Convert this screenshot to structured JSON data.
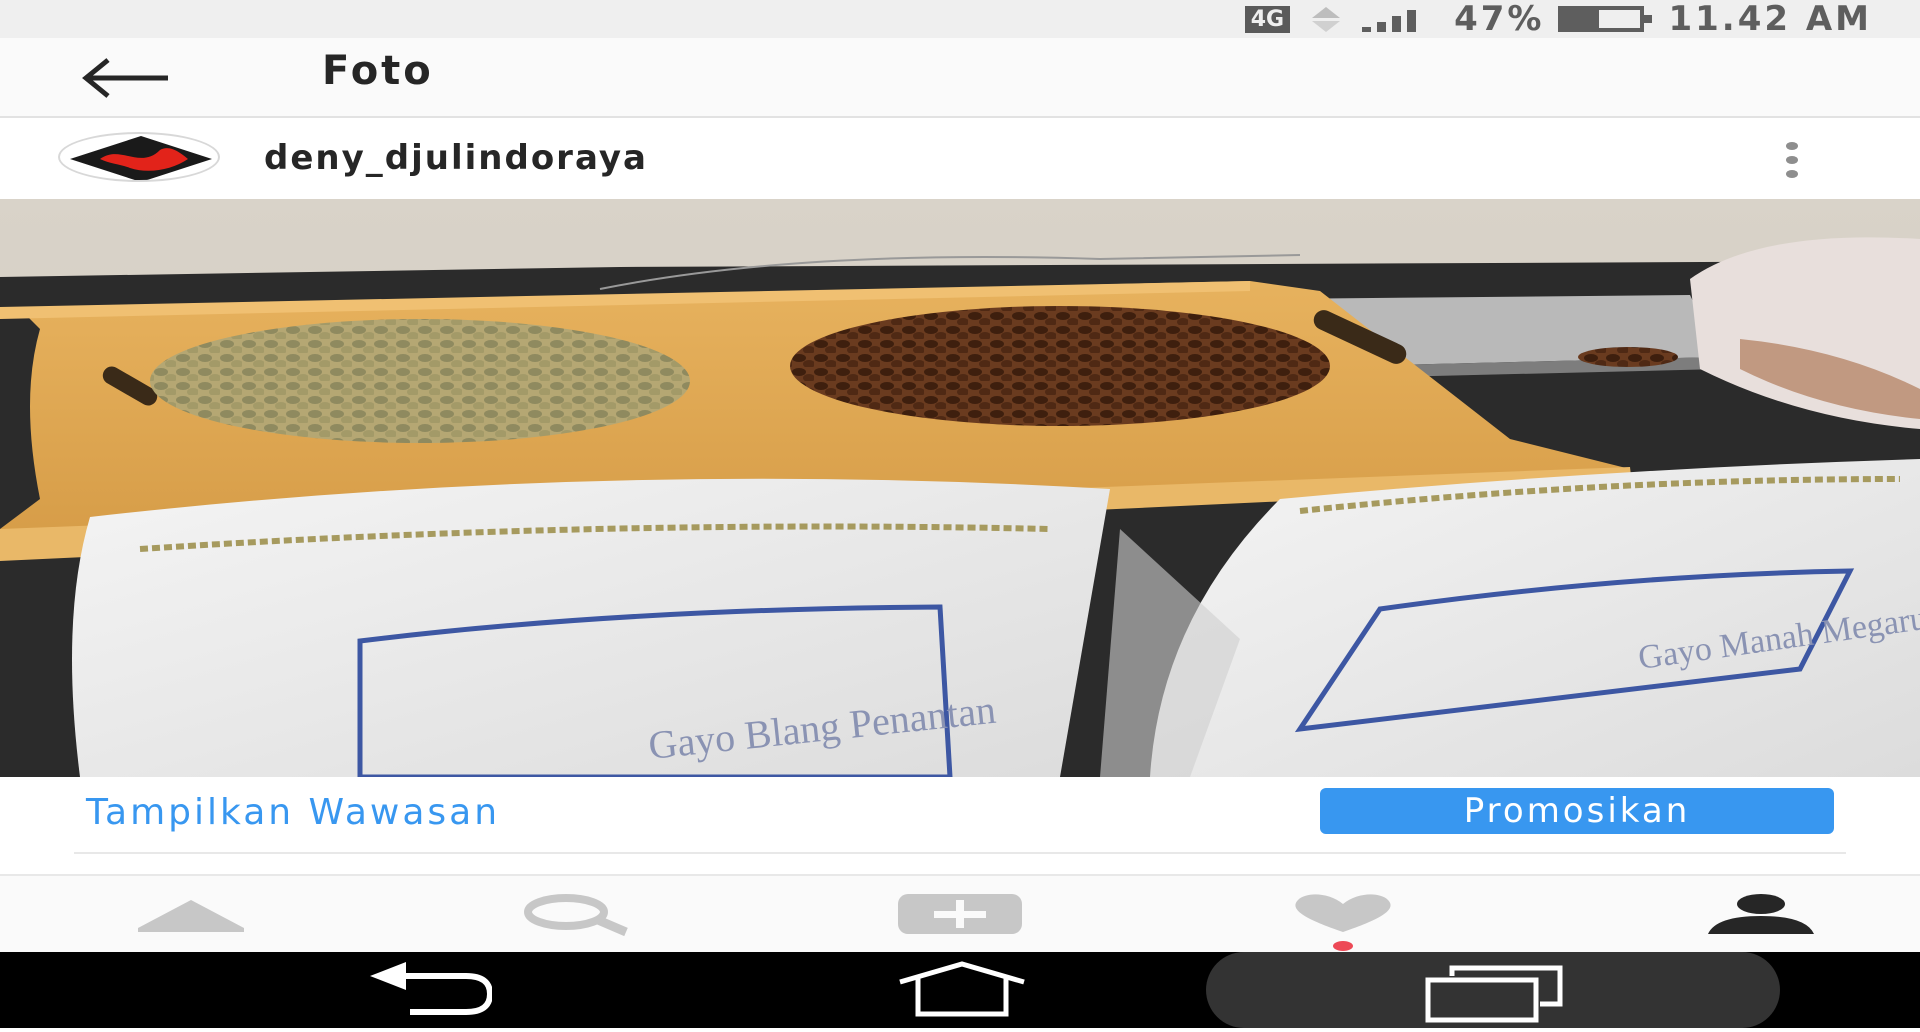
{
  "status_bar": {
    "network": "4G",
    "battery": "47%",
    "battery_level": 0.47,
    "time": "11.42 AM",
    "icons": [
      "data-arrows-icon",
      "signal-icon",
      "battery-icon"
    ]
  },
  "top_bar": {
    "back_icon": "arrow-left-icon",
    "title": "Foto"
  },
  "post": {
    "username": "deny_djulindoraya",
    "more_icon": "more-vertical-icon",
    "photo_labels": [
      "Gayo Blang Penantan",
      "Gayo Manah Megaru"
    ]
  },
  "actions": {
    "insights_link": "Tampilkan Wawasan",
    "promote_button": "Promosikan"
  },
  "bottom_nav": {
    "items": [
      "home-icon",
      "search-icon",
      "add-post-icon",
      "activity-heart-icon",
      "profile-icon"
    ],
    "active": "profile-icon"
  },
  "system_nav": {
    "items": [
      "back-icon",
      "home-icon",
      "recent-apps-icon"
    ]
  },
  "colors": {
    "accent": "#3897f0",
    "text": "#262626",
    "icon_inactive": "#c7c7c7",
    "notification_dot": "#ed4956"
  }
}
